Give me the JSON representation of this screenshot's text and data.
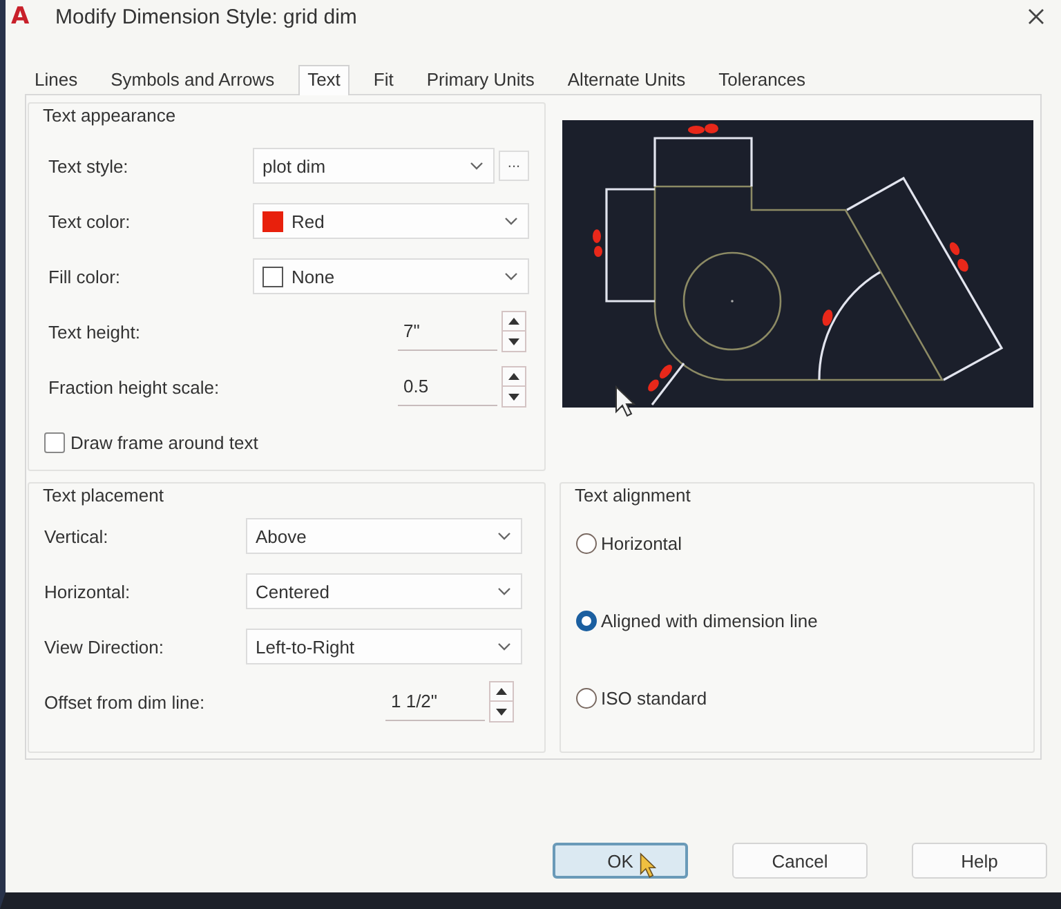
{
  "window": {
    "logo": "A",
    "title": "Modify Dimension Style: grid dim"
  },
  "tabs": [
    {
      "label": "Lines",
      "selected": false
    },
    {
      "label": "Symbols and Arrows",
      "selected": false
    },
    {
      "label": "Text",
      "selected": true
    },
    {
      "label": "Fit",
      "selected": false
    },
    {
      "label": "Primary Units",
      "selected": false
    },
    {
      "label": "Alternate Units",
      "selected": false
    },
    {
      "label": "Tolerances",
      "selected": false
    }
  ],
  "text_appearance": {
    "title": "Text appearance",
    "fields": [
      {
        "kind": "dropdown",
        "label": "Text style:",
        "value": "plot dim",
        "button": "..."
      },
      {
        "kind": "color",
        "label": "Text color:",
        "value": "Red",
        "color": "#e8200c"
      },
      {
        "kind": "color",
        "label": "Fill color:",
        "value": "None"
      },
      {
        "kind": "spinner",
        "label": "Text height:",
        "value": "7\""
      },
      {
        "kind": "spinner",
        "label": "Fraction height scale:",
        "value": "0.5"
      }
    ],
    "checkbox": {
      "label": "Draw frame around text",
      "checked": false
    }
  },
  "text_placement": {
    "title": "Text placement",
    "fields": [
      {
        "kind": "dropdown",
        "label": "Vertical:",
        "value": "Above"
      },
      {
        "kind": "dropdown",
        "label": "Horizontal:",
        "value": "Centered"
      },
      {
        "kind": "dropdown",
        "label": "View Direction:",
        "value": "Left-to-Right"
      },
      {
        "kind": "spinner",
        "label": "Offset from dim line:",
        "value": "1 1/2\""
      }
    ]
  },
  "text_alignment": {
    "title": "Text alignment",
    "options": [
      {
        "label": "Horizontal",
        "selected": false
      },
      {
        "label": "Aligned with dimension line",
        "selected": true
      },
      {
        "label": "ISO standard",
        "selected": false
      }
    ]
  },
  "buttons": [
    {
      "label": "OK",
      "focused": true
    },
    {
      "label": "Cancel",
      "focused": false
    },
    {
      "label": "Help",
      "focused": false
    }
  ]
}
